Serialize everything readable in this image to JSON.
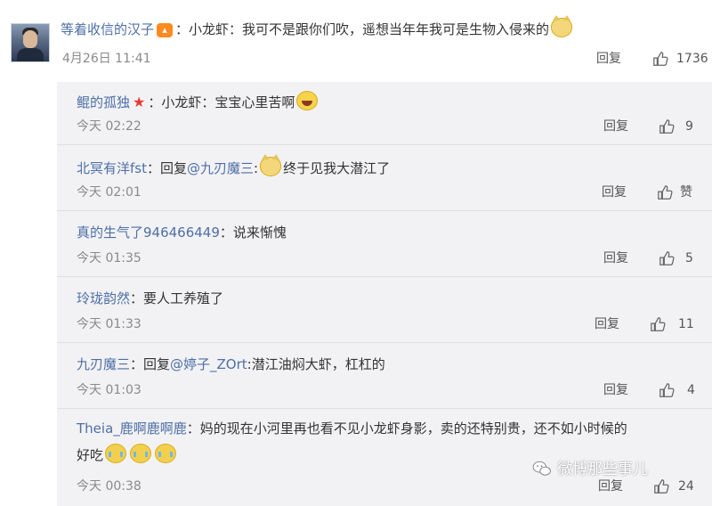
{
  "main_comment": {
    "username": "等着收信的汉子",
    "content": "：小龙虾：我可不是跟你们吹，遥想当年年我可是生物入侵来的",
    "time": "4月26日 11:41",
    "reply_label": "回复",
    "likes": "1736"
  },
  "replies": [
    {
      "username": "鲲的孤独",
      "content": "：小龙虾：宝宝心里苦啊",
      "time": "今天 02:22",
      "reply_label": "回复",
      "likes": "9"
    },
    {
      "username": "北冥有洋fst",
      "content_prefix": "：回复",
      "mention": "@九刃魔三",
      "content": ":",
      "content_after": "终于见我大潜江了",
      "time": "今天 02:01",
      "reply_label": "回复",
      "likes": "赞"
    },
    {
      "username": "真的生气了946466449",
      "content": "：说来惭愧",
      "time": "今天 01:35",
      "reply_label": "回复",
      "likes": "5"
    },
    {
      "username": "玲珑韵然",
      "content": "：要人工养殖了",
      "time": "今天 01:33",
      "reply_label": "回复",
      "likes": "11"
    },
    {
      "username": "九刃魔三",
      "content_prefix": "：回复",
      "mention": "@婷子_ZOrt",
      "content": ":潜江油焖大虾，杠杠的",
      "time": "今天 01:03",
      "reply_label": "回复",
      "likes": "4"
    },
    {
      "username": "Theia_鹿啊鹿啊鹿",
      "content": "：妈的现在小河里再也看不见小龙虾身影，卖的还特别贵，还不如小时候的",
      "content_line2": "好吃",
      "time": "今天 00:38",
      "reply_label": "回复",
      "likes": "24"
    }
  ],
  "watermark": "微博那些事儿",
  "colors": {
    "link": "#4e6fa5",
    "reply_bg": "#f2f2f5",
    "vip": "#ff8a1f"
  },
  "icons": [
    "thumb-up-icon",
    "vip-badge-icon",
    "red-star-icon",
    "cat-emoji-icon",
    "laugh-emoji-icon",
    "cry-emoji-icon",
    "wechat-icon"
  ]
}
